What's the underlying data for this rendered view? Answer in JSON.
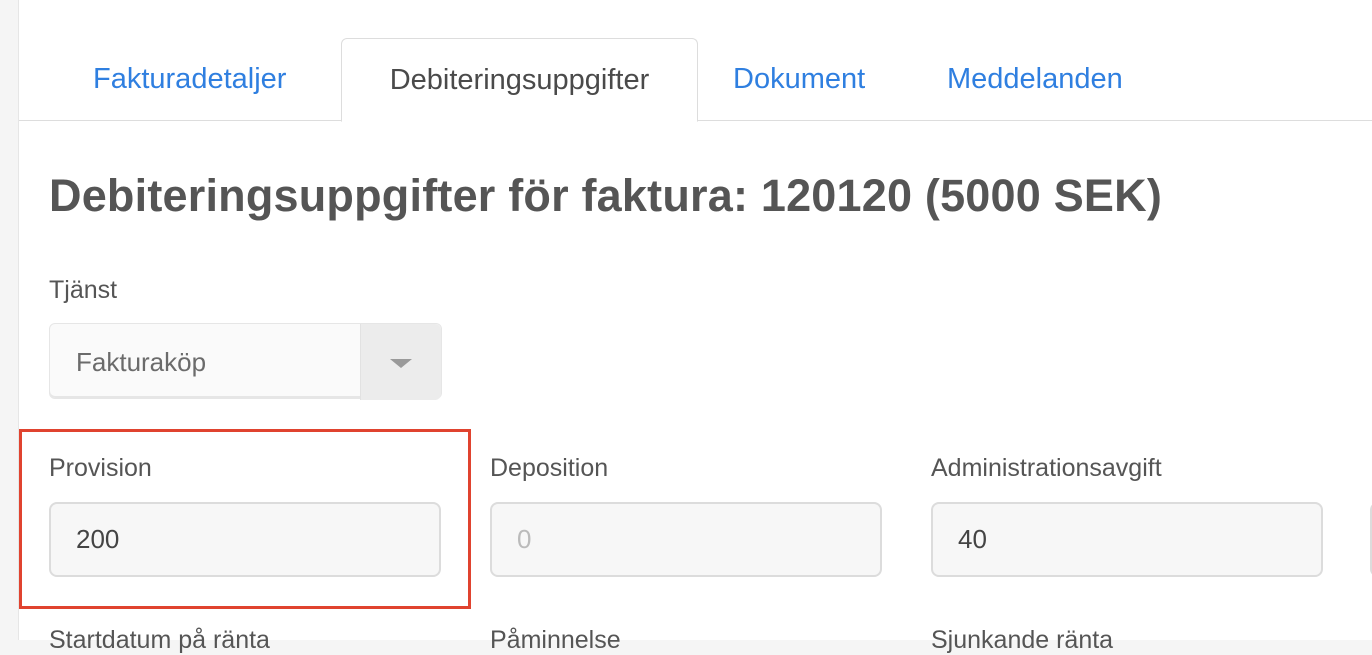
{
  "tabs": [
    {
      "label": "Fakturadetaljer",
      "active": false
    },
    {
      "label": "Debiteringsuppgifter",
      "active": true
    },
    {
      "label": "Dokument",
      "active": false
    },
    {
      "label": "Meddelanden",
      "active": false
    }
  ],
  "page_title": "Debiteringsuppgifter för faktura: 120120 (5000 SEK)",
  "service": {
    "label": "Tjänst",
    "selected": "Fakturaköp"
  },
  "provision": {
    "label": "Provision",
    "value": "200"
  },
  "deposition": {
    "label": "Deposition",
    "placeholder": "0"
  },
  "admin_fee": {
    "label": "Administrationsavgift",
    "value": "40"
  },
  "highlight_color": "#e0432f",
  "link_color": "#2f7fe0",
  "row_below_labels": [
    "Startdatum på ränta",
    "Påminnelse",
    "Sjunkande ränta"
  ]
}
